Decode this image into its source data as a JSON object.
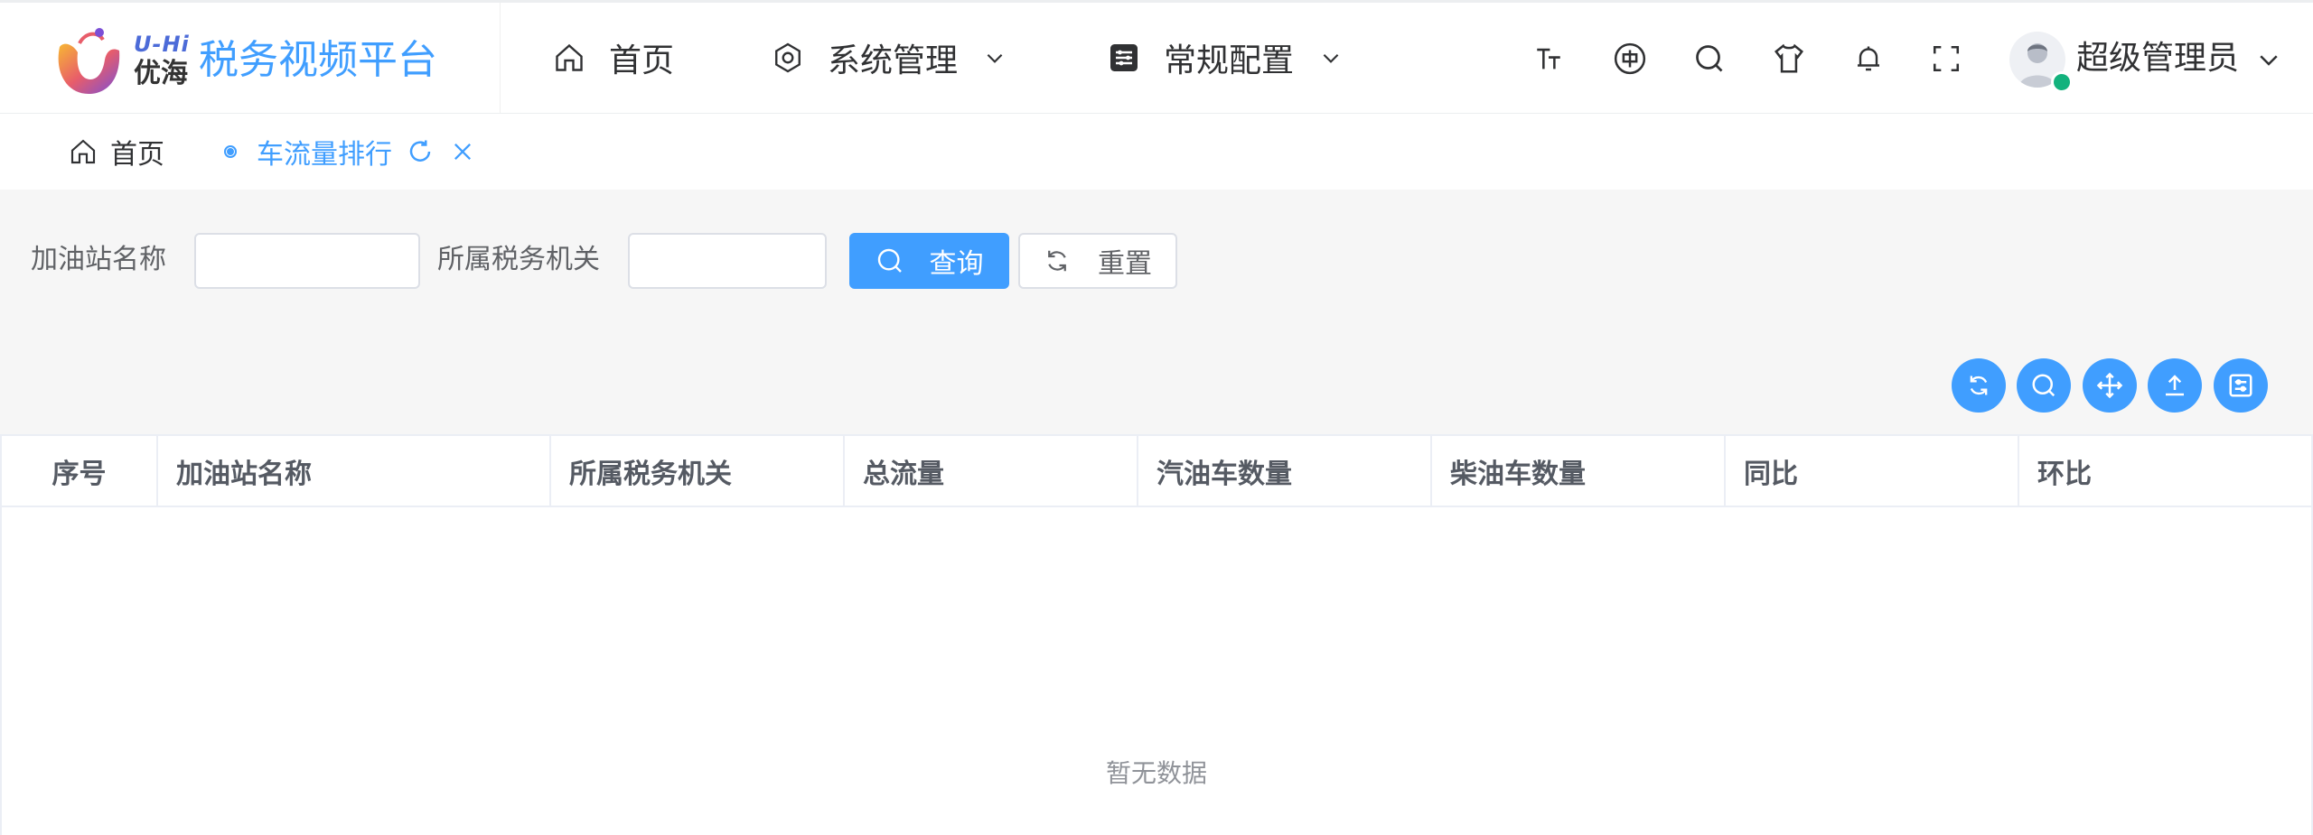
{
  "header": {
    "logo_en": "U-Hi",
    "logo_cn": "优海",
    "site_title": "税务视频平台",
    "nav": [
      {
        "label": "首页",
        "icon": "home-icon"
      },
      {
        "label": "系统管理",
        "icon": "gear-icon"
      },
      {
        "label": "常规配置",
        "icon": "config-icon"
      }
    ],
    "tools": [
      "font-size-icon",
      "language-icon",
      "search-icon",
      "theme-icon",
      "bell-icon",
      "fullscreen-icon"
    ],
    "user_name": "超级管理员"
  },
  "tabs": {
    "home": "首页",
    "active": "车流量排行"
  },
  "search_form": {
    "station_label": "加油站名称",
    "station_value": "",
    "tax_office_label": "所属税务机关",
    "tax_office_value": "",
    "query_label": "查询",
    "reset_label": "重置"
  },
  "toolbar_icons": [
    "refresh-icon",
    "search-icon",
    "move-icon",
    "export-icon",
    "columns-icon"
  ],
  "table": {
    "columns": [
      "序号",
      "加油站名称",
      "所属税务机关",
      "总流量",
      "汽油车数量",
      "柴油车数量",
      "同比",
      "环比"
    ],
    "rows": [],
    "empty_text": "暂无数据"
  },
  "colors": {
    "primary": "#409eff",
    "online": "#13b27d"
  }
}
